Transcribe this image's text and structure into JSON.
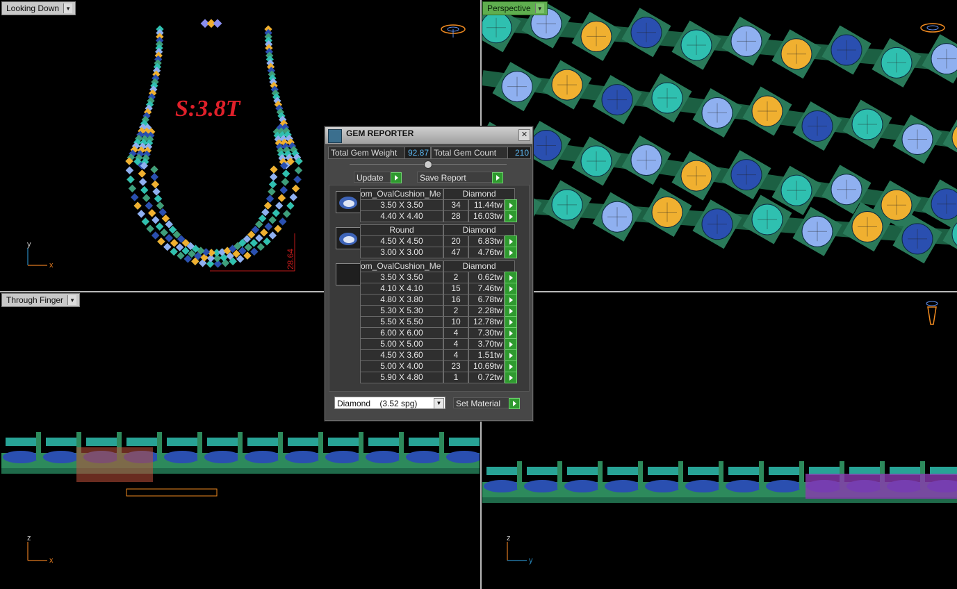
{
  "viewports": {
    "top_left": {
      "label": "Looking Down",
      "annotation": "S:3.8T",
      "dimension": "28.64",
      "axis_v": "y",
      "axis_h": "x"
    },
    "top_right": {
      "label": "Perspective"
    },
    "bottom_left": {
      "label": "Through Finger",
      "axis_v": "z",
      "axis_h": "x"
    },
    "bottom_right": {
      "axis_v": "z",
      "axis_h": "y"
    }
  },
  "gem_reporter": {
    "title": "GEM REPORTER",
    "close_label": "✕",
    "total_weight_label": "Total Gem Weight",
    "total_weight_value": "92.87",
    "total_count_label": "Total Gem Count",
    "total_count_value": "210",
    "update_label": "Update",
    "save_report_label": "Save Report",
    "groups": [
      {
        "shape": "om_OvalCushion_Me",
        "material": "Diamond",
        "rows": [
          {
            "size": "3.50 X 3.50",
            "count": "34",
            "weight": "11.44tw"
          },
          {
            "size": "4.40 X 4.40",
            "count": "28",
            "weight": "16.03tw"
          }
        ]
      },
      {
        "shape": "Round",
        "material": "Diamond",
        "rows": [
          {
            "size": "4.50 X 4.50",
            "count": "20",
            "weight": "6.83tw"
          },
          {
            "size": "3.00 X 3.00",
            "count": "47",
            "weight": "4.76tw"
          }
        ]
      },
      {
        "shape": "om_OvalCushion_Me",
        "material": "Diamond",
        "rows": [
          {
            "size": "3.50 X 3.50",
            "count": "2",
            "weight": "0.62tw"
          },
          {
            "size": "4.10 X 4.10",
            "count": "15",
            "weight": "7.46tw"
          },
          {
            "size": "4.80 X 3.80",
            "count": "16",
            "weight": "6.78tw"
          },
          {
            "size": "5.30 X 5.30",
            "count": "2",
            "weight": "2.28tw"
          },
          {
            "size": "5.50 X 5.50",
            "count": "10",
            "weight": "12.78tw"
          },
          {
            "size": "6.00 X 6.00",
            "count": "4",
            "weight": "7.30tw"
          },
          {
            "size": "5.00 X 5.00",
            "count": "4",
            "weight": "3.70tw"
          },
          {
            "size": "4.50 X 3.60",
            "count": "4",
            "weight": "1.51tw"
          },
          {
            "size": "5.00 X 4.00",
            "count": "23",
            "weight": "10.69tw"
          },
          {
            "size": "5.90 X 4.80",
            "count": "1",
            "weight": "0.72tw"
          }
        ]
      }
    ],
    "material_select": "Diamond    (3.52 spg)",
    "set_material_label": "Set Material"
  }
}
